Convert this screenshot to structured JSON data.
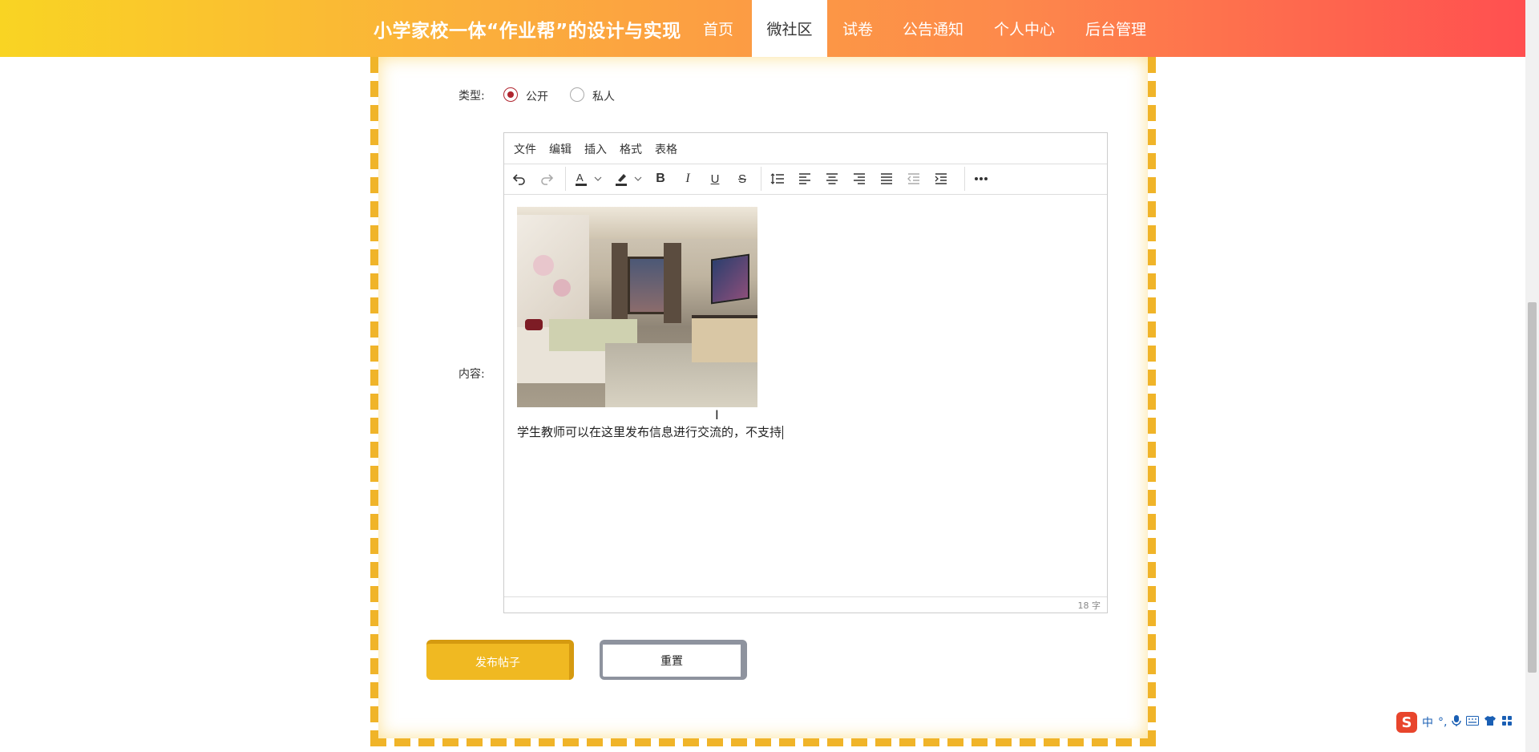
{
  "header": {
    "site_title": "小学家校一体“作业帮”的设计与实现",
    "nav": [
      {
        "label": "首页",
        "active": false
      },
      {
        "label": "微社区",
        "active": true
      },
      {
        "label": "试卷",
        "active": false
      },
      {
        "label": "公告通知",
        "active": false
      },
      {
        "label": "个人中心",
        "active": false
      },
      {
        "label": "后台管理",
        "active": false
      }
    ]
  },
  "form": {
    "type_label": "类型:",
    "type_options": [
      {
        "label": "公开",
        "checked": true
      },
      {
        "label": "私人",
        "checked": false
      }
    ],
    "content_label": "内容:",
    "editor": {
      "menu": [
        "文件",
        "编辑",
        "插入",
        "格式",
        "表格"
      ],
      "toolbar_icons": [
        "undo-icon",
        "redo-icon",
        "text-color-icon",
        "highlight-icon",
        "bold-icon",
        "italic-icon",
        "underline-icon",
        "strikethrough-icon",
        "line-height-icon",
        "align-left-icon",
        "align-center-icon",
        "align-right-icon",
        "align-justify-icon",
        "outdent-icon",
        "indent-icon",
        "more-icon"
      ],
      "content_text": "学生教师可以在这里发布信息进行交流的，不支持",
      "word_count": "18 字"
    },
    "publish_label": "发布帖子",
    "reset_label": "重置"
  },
  "ime": {
    "lang": "中",
    "punct": "°,"
  },
  "colors": {
    "accent_start": "#f9d423",
    "accent_end": "#ff4e50",
    "frame": "#f0b429",
    "radio_checked": "#b0252f"
  }
}
